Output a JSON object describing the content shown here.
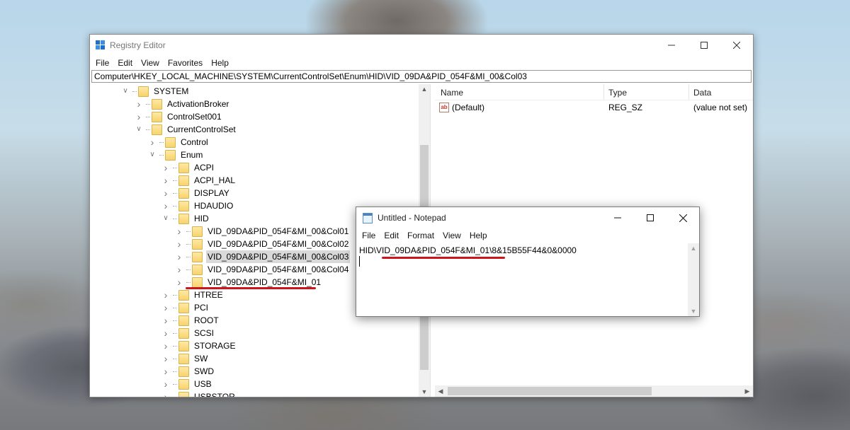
{
  "registry": {
    "title": "Registry Editor",
    "menu": [
      "File",
      "Edit",
      "View",
      "Favorites",
      "Help"
    ],
    "address": "Computer\\HKEY_LOCAL_MACHINE\\SYSTEM\\CurrentControlSet\\Enum\\HID\\VID_09DA&PID_054F&MI_00&Col03",
    "tree": [
      {
        "label": "SYSTEM",
        "level": 0,
        "expander": "expanded"
      },
      {
        "label": "ActivationBroker",
        "level": 1,
        "expander": "collapsed"
      },
      {
        "label": "ControlSet001",
        "level": 1,
        "expander": "collapsed"
      },
      {
        "label": "CurrentControlSet",
        "level": 1,
        "expander": "expanded"
      },
      {
        "label": "Control",
        "level": 2,
        "expander": "collapsed"
      },
      {
        "label": "Enum",
        "level": 2,
        "expander": "expanded"
      },
      {
        "label": "ACPI",
        "level": 3,
        "expander": "collapsed"
      },
      {
        "label": "ACPI_HAL",
        "level": 3,
        "expander": "collapsed"
      },
      {
        "label": "DISPLAY",
        "level": 3,
        "expander": "collapsed"
      },
      {
        "label": "HDAUDIO",
        "level": 3,
        "expander": "collapsed"
      },
      {
        "label": "HID",
        "level": 3,
        "expander": "expanded"
      },
      {
        "label": "VID_09DA&PID_054F&MI_00&Col01",
        "level": 4,
        "expander": "collapsed"
      },
      {
        "label": "VID_09DA&PID_054F&MI_00&Col02",
        "level": 4,
        "expander": "collapsed"
      },
      {
        "label": "VID_09DA&PID_054F&MI_00&Col03",
        "level": 4,
        "expander": "collapsed",
        "selected": true
      },
      {
        "label": "VID_09DA&PID_054F&MI_00&Col04",
        "level": 4,
        "expander": "collapsed"
      },
      {
        "label": "VID_09DA&PID_054F&MI_01",
        "level": 4,
        "expander": "collapsed"
      },
      {
        "label": "HTREE",
        "level": 3,
        "expander": "collapsed"
      },
      {
        "label": "PCI",
        "level": 3,
        "expander": "collapsed"
      },
      {
        "label": "ROOT",
        "level": 3,
        "expander": "collapsed"
      },
      {
        "label": "SCSI",
        "level": 3,
        "expander": "collapsed"
      },
      {
        "label": "STORAGE",
        "level": 3,
        "expander": "collapsed"
      },
      {
        "label": "SW",
        "level": 3,
        "expander": "collapsed"
      },
      {
        "label": "SWD",
        "level": 3,
        "expander": "collapsed"
      },
      {
        "label": "USB",
        "level": 3,
        "expander": "collapsed"
      },
      {
        "label": "USBSTOR",
        "level": 3,
        "expander": "collapsed"
      }
    ],
    "columns": {
      "name": "Name",
      "type": "Type",
      "data": "Data"
    },
    "values": [
      {
        "name": "(Default)",
        "type": "REG_SZ",
        "data": "(value not set)",
        "icon": "string-value-icon"
      }
    ]
  },
  "notepad": {
    "title": "Untitled - Notepad",
    "menu": [
      "File",
      "Edit",
      "Format",
      "View",
      "Help"
    ],
    "text": "HID\\VID_09DA&PID_054F&MI_01\\8&15B55F44&0&0000"
  },
  "annotations": {
    "underline_color": "#d0141b"
  }
}
